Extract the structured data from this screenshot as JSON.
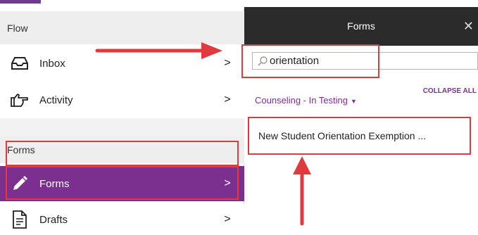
{
  "sidebar": {
    "flow_header": "Flow",
    "items": [
      {
        "label": "Inbox",
        "icon": "inbox-icon"
      },
      {
        "label": "Activity",
        "icon": "thumbs-pointing-icon"
      }
    ],
    "forms_header": "Forms",
    "forms_item": {
      "label": "Forms",
      "icon": "pencil-icon"
    },
    "drafts_item": {
      "label": "Drafts",
      "icon": "document-icon"
    },
    "chevron": ">"
  },
  "panel": {
    "title": "Forms",
    "close": "✕",
    "search_value": "orientation",
    "group_label": "Counseling - In Testing",
    "group_caret": "▼",
    "collapse_all": "COLLAPSE ALL",
    "form_item": "New Student Orientation Exemption ..."
  },
  "colors": {
    "accent_purple": "#7b2f8f",
    "header_dark": "#2b2b2b",
    "annotation_red": "#e0393e"
  }
}
